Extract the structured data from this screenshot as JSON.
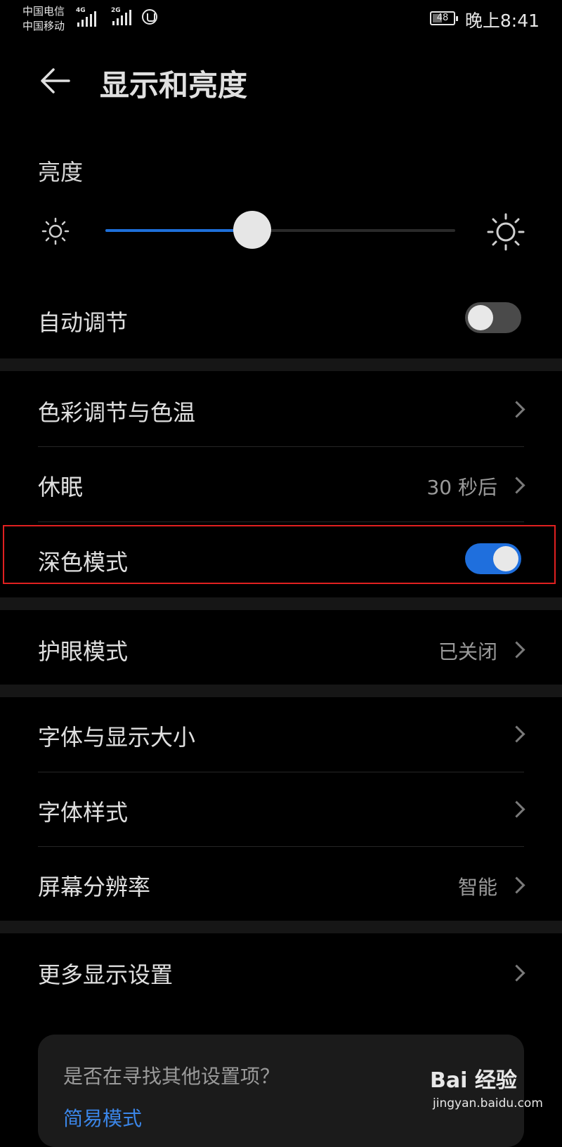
{
  "status_bar": {
    "carrier_1": "中国电信",
    "carrier_2": "中国移动",
    "network_1": "4G",
    "network_2": "2G",
    "battery": "48",
    "time": "晚上8:41"
  },
  "header": {
    "title": "显示和亮度",
    "back_icon": "arrow-left-icon"
  },
  "brightness": {
    "label": "亮度",
    "level": 0.42,
    "min_icon": "sun-small-icon",
    "max_icon": "sun-large-icon"
  },
  "auto_adjust": {
    "label": "自动调节",
    "on": false
  },
  "color_temp": {
    "label": "色彩调节与色温"
  },
  "sleep": {
    "label": "休眠",
    "value": "30 秒后"
  },
  "dark_mode": {
    "label": "深色模式",
    "on": true
  },
  "eye_comfort": {
    "label": "护眼模式",
    "value": "已关闭"
  },
  "font_size": {
    "label": "字体与显示大小"
  },
  "font_style": {
    "label": "字体样式"
  },
  "resolution": {
    "label": "屏幕分辨率",
    "value": "智能"
  },
  "more_display": {
    "label": "更多显示设置"
  },
  "suggestion_card": {
    "question": "是否在寻找其他设置项？",
    "link": "简易模式"
  },
  "watermark": {
    "brand": "Bai 经验",
    "url": "jingyan.baidu.com"
  },
  "colors": {
    "accent": "#1f6fdd",
    "highlight_border": "#e02020",
    "background": "#000000"
  }
}
